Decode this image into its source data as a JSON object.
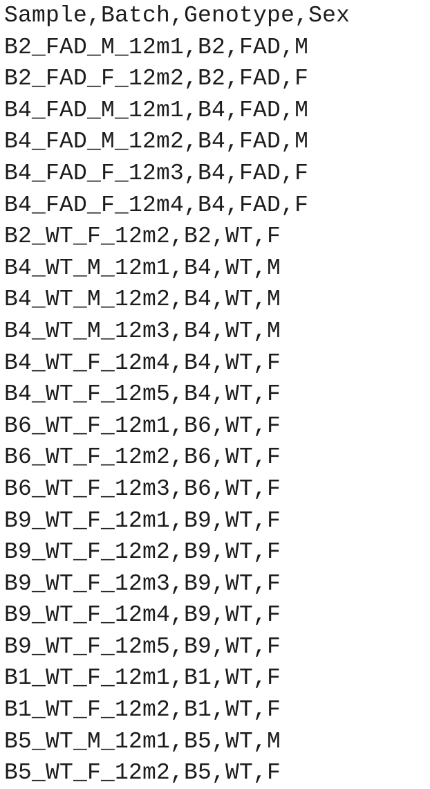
{
  "lines": [
    "Sample,Batch,Genotype,Sex",
    "B2_FAD_M_12m1,B2,FAD,M",
    "B2_FAD_F_12m2,B2,FAD,F",
    "B4_FAD_M_12m1,B4,FAD,M",
    "B4_FAD_M_12m2,B4,FAD,M",
    "B4_FAD_F_12m3,B4,FAD,F",
    "B4_FAD_F_12m4,B4,FAD,F",
    "B2_WT_F_12m2,B2,WT,F",
    "B4_WT_M_12m1,B4,WT,M",
    "B4_WT_M_12m2,B4,WT,M",
    "B4_WT_M_12m3,B4,WT,M",
    "B4_WT_F_12m4,B4,WT,F",
    "B4_WT_F_12m5,B4,WT,F",
    "B6_WT_F_12m1,B6,WT,F",
    "B6_WT_F_12m2,B6,WT,F",
    "B6_WT_F_12m3,B6,WT,F",
    "B9_WT_F_12m1,B9,WT,F",
    "B9_WT_F_12m2,B9,WT,F",
    "B9_WT_F_12m3,B9,WT,F",
    "B9_WT_F_12m4,B9,WT,F",
    "B9_WT_F_12m5,B9,WT,F",
    "B1_WT_F_12m1,B1,WT,F",
    "B1_WT_F_12m2,B1,WT,F",
    "B5_WT_M_12m1,B5,WT,M",
    "B5_WT_F_12m2,B5,WT,F"
  ]
}
